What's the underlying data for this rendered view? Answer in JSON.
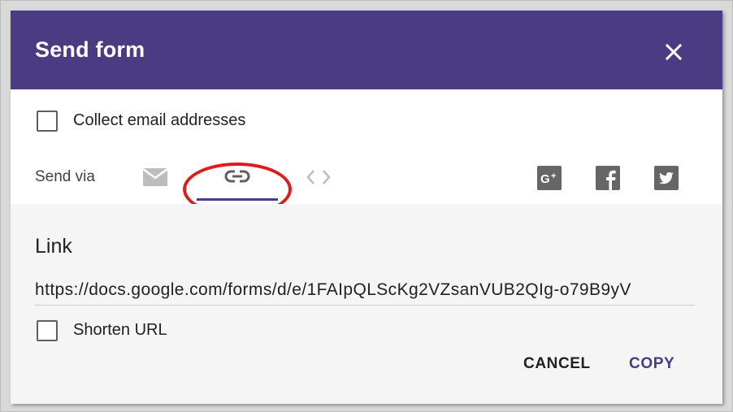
{
  "dialog": {
    "title": "Send form",
    "close_icon": "close-icon"
  },
  "collect_email": {
    "label": "Collect email addresses",
    "checked": false
  },
  "send_via": {
    "label": "Send via",
    "methods": [
      {
        "icon": "email-icon"
      },
      {
        "icon": "link-icon",
        "selected": true
      },
      {
        "icon": "embed-code-icon"
      }
    ],
    "share": [
      {
        "icon": "google-plus-icon"
      },
      {
        "icon": "facebook-icon"
      },
      {
        "icon": "twitter-icon"
      }
    ]
  },
  "link": {
    "heading": "Link",
    "url": "https://docs.google.com/forms/d/e/1FAIpQLScKg2VZsanVUB2QIg-o79B9yV",
    "shorten_label": "Shorten URL",
    "shorten_checked": false
  },
  "actions": {
    "cancel": "CANCEL",
    "copy": "COPY"
  },
  "colors": {
    "header_bg": "#4a3b82",
    "accent": "#4a3b82",
    "annotation": "#e01b1b",
    "lower_bg": "#f5f5f5"
  }
}
